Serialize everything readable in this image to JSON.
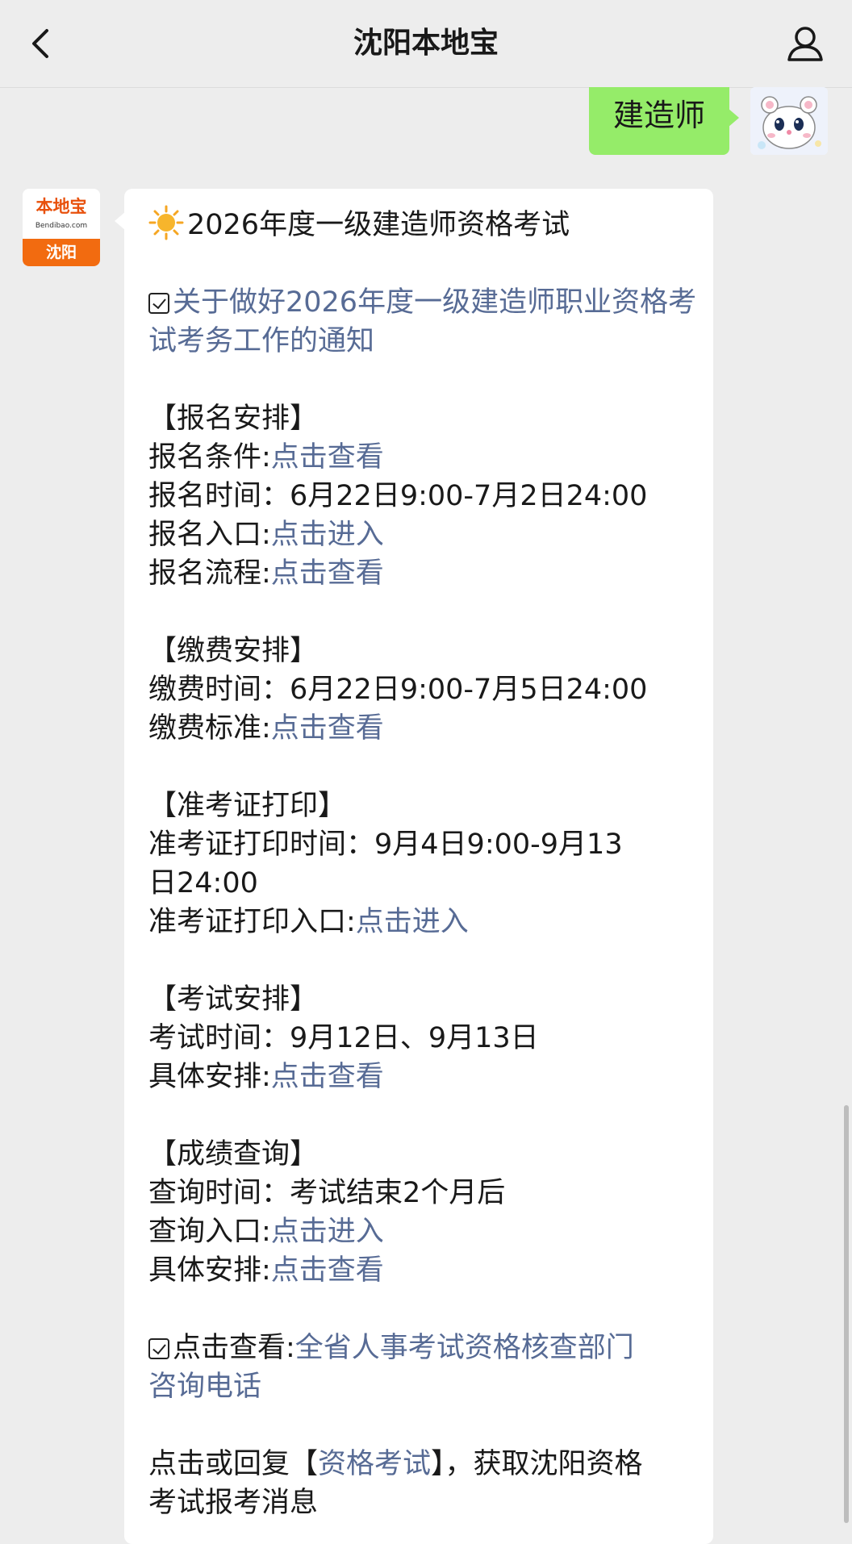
{
  "header": {
    "title": "沈阳本地宝"
  },
  "sent_message": {
    "text": "建造师"
  },
  "bot_avatar": {
    "brand": "本地宝",
    "domain": "Bendibao.com",
    "city": "沈阳"
  },
  "message": {
    "headline": "2026年度一级建造师资格考试",
    "notice_link": "关于做好2026年度一级建造师职业资格考试考务工作的通知",
    "sections": {
      "registration": {
        "title": "【报名安排】",
        "conditions_label": "报名条件:",
        "conditions_link": "点击查看",
        "time_label": "报名时间：",
        "time_value": "6月22日9:00-7月2日24:00",
        "entry_label": "报名入口:",
        "entry_link": "点击进入",
        "process_label": "报名流程:",
        "process_link": "点击查看"
      },
      "payment": {
        "title": "【缴费安排】",
        "time_label": "缴费时间：",
        "time_value": "6月22日9:00-7月5日24:00",
        "standard_label": "缴费标准:",
        "standard_link": "点击查看"
      },
      "admission": {
        "title": "【准考证打印】",
        "time_label": "准考证打印时间：",
        "time_value_1": "9月4日9:00-9月13",
        "time_value_2": "日24:00",
        "entry_label": "准考证打印入口:",
        "entry_link": "点击进入"
      },
      "exam": {
        "title": "【考试安排】",
        "time_label": "考试时间：",
        "time_value": "9月12日、9月13日",
        "detail_label": "具体安排:",
        "detail_link": "点击查看"
      },
      "score": {
        "title": "【成绩查询】",
        "time_label": "查询时间：",
        "time_value": "考试结束2个月后",
        "entry_label": "查询入口:",
        "entry_link": "点击进入",
        "detail_label": "具体安排:",
        "detail_link": "点击查看"
      }
    },
    "phone": {
      "label": "点击查看:",
      "link_1": "全省人事考试资格核查部门",
      "link_2": "咨询电话"
    },
    "footer": {
      "prefix": "点击或回复【",
      "link": "资格考试",
      "suffix_1": "】，获取沈阳资格",
      "suffix_2": "考试报考消息"
    }
  }
}
